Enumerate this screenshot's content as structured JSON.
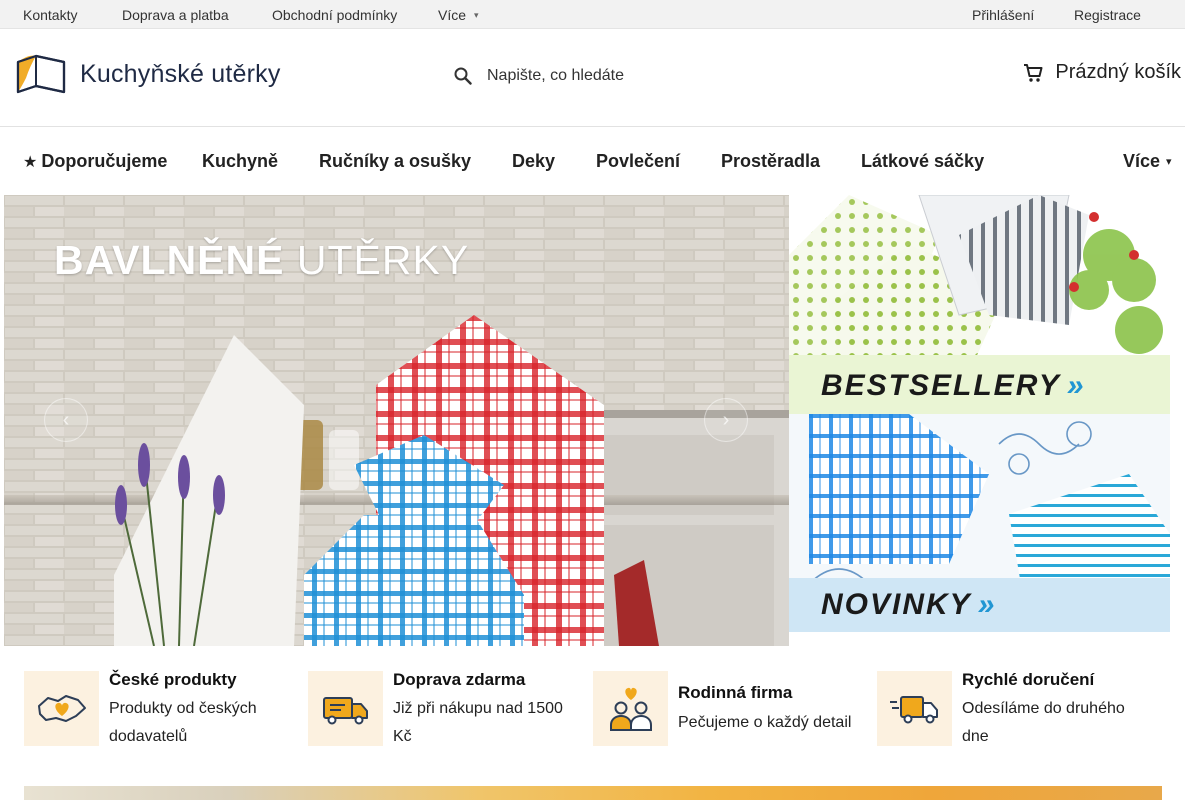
{
  "topbar": {
    "links": [
      "Kontakty",
      "Doprava a platba",
      "Obchodní podmínky",
      "Více"
    ],
    "login": "Přihlášení",
    "register": "Registrace"
  },
  "header": {
    "logo_text": "Kuchyňské utěrky",
    "search_placeholder": "Napište, co hledáte",
    "cart_label": "Prázdný košík"
  },
  "nav": {
    "items": [
      "Doporučujeme",
      "Kuchyně",
      "Ručníky a osušky",
      "Deky",
      "Povlečení",
      "Prostěradla",
      "Látkové sáčky",
      "Více"
    ]
  },
  "hero": {
    "title_bold": "BAVLNĚNÉ",
    "title_light": "UTĚRKY",
    "prev_icon": "chevron-left-icon",
    "next_icon": "chevron-right-icon"
  },
  "promos": {
    "bestsellery": "BESTSELLERY",
    "novinky": "NOVINKY"
  },
  "benefits": [
    {
      "title": "České produkty",
      "desc": "Produkty od českých dodavatelů",
      "icon": "czech-heart-icon"
    },
    {
      "title": "Doprava zdarma",
      "desc": "Již při nákupu nad 1500 Kč",
      "icon": "delivery-truck-icon"
    },
    {
      "title": "Rodinná firma",
      "desc": "Pečujeme o každý detail",
      "icon": "family-icon"
    },
    {
      "title": "Rychlé doručení",
      "desc": "Odesíláme do druhého dne",
      "icon": "fast-truck-icon"
    }
  ],
  "colors": {
    "accent": "#2196d3",
    "topbar_bg": "#f2f2f2",
    "benefit_icon_bg": "#fcf1e0",
    "icon_orange": "#f0a81c"
  }
}
